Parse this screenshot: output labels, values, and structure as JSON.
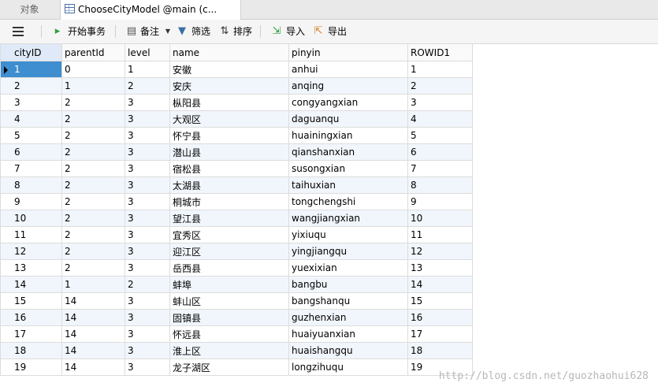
{
  "tabs": {
    "objects": "对象",
    "table": "ChooseCityModel @main (c..."
  },
  "toolbar": {
    "begin_transaction": "开始事务",
    "memo": "备注",
    "filter": "筛选",
    "sort": "排序",
    "import": "导入",
    "export": "导出"
  },
  "columns": [
    "cityID",
    "parentId",
    "level",
    "name",
    "pinyin",
    "ROWID1"
  ],
  "rows": [
    [
      "1",
      "0",
      "1",
      "安徽",
      "anhui",
      "1"
    ],
    [
      "2",
      "1",
      "2",
      "安庆",
      "anqing",
      "2"
    ],
    [
      "3",
      "2",
      "3",
      "枞阳县",
      "congyangxian",
      "3"
    ],
    [
      "4",
      "2",
      "3",
      "大观区",
      "daguanqu",
      "4"
    ],
    [
      "5",
      "2",
      "3",
      "怀宁县",
      "huainingxian",
      "5"
    ],
    [
      "6",
      "2",
      "3",
      "潜山县",
      "qianshanxian",
      "6"
    ],
    [
      "7",
      "2",
      "3",
      "宿松县",
      "susongxian",
      "7"
    ],
    [
      "8",
      "2",
      "3",
      "太湖县",
      "taihuxian",
      "8"
    ],
    [
      "9",
      "2",
      "3",
      "桐城市",
      "tongchengshi",
      "9"
    ],
    [
      "10",
      "2",
      "3",
      "望江县",
      "wangjiangxian",
      "10"
    ],
    [
      "11",
      "2",
      "3",
      "宜秀区",
      "yixiuqu",
      "11"
    ],
    [
      "12",
      "2",
      "3",
      "迎江区",
      "yingjiangqu",
      "12"
    ],
    [
      "13",
      "2",
      "3",
      "岳西县",
      "yuexixian",
      "13"
    ],
    [
      "14",
      "1",
      "2",
      "蚌埠",
      "bangbu",
      "14"
    ],
    [
      "15",
      "14",
      "3",
      "蚌山区",
      "bangshanqu",
      "15"
    ],
    [
      "16",
      "14",
      "3",
      "固镇县",
      "guzhenxian",
      "16"
    ],
    [
      "17",
      "14",
      "3",
      "怀远县",
      "huaiyuanxian",
      "17"
    ],
    [
      "18",
      "14",
      "3",
      "淮上区",
      "huaishangqu",
      "18"
    ],
    [
      "19",
      "14",
      "3",
      "龙子湖区",
      "longzihuqu",
      "19"
    ]
  ],
  "watermark": "http://blog.csdn.net/guozhaohui628",
  "colors": {
    "selected": "#3e8ed0",
    "alt_row": "#f1f6fc",
    "header_sorted": "#dfe9f7"
  }
}
